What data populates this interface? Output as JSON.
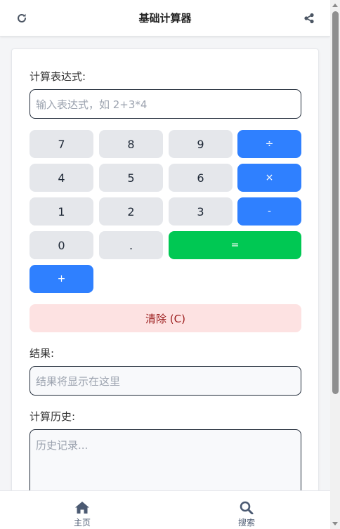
{
  "header": {
    "title": "基础计算器",
    "left_icon": "refresh-icon",
    "right_icon": "share-icon"
  },
  "calculator": {
    "expression_label": "计算表达式:",
    "expression_placeholder": "输入表达式，如 2+3*4",
    "keys": {
      "k7": "7",
      "k8": "8",
      "k9": "9",
      "div": "÷",
      "k4": "4",
      "k5": "5",
      "k6": "6",
      "mul": "×",
      "k1": "1",
      "k2": "2",
      "k3": "3",
      "sub": "-",
      "k0": "0",
      "dot": ".",
      "eq": "=",
      "add": "+"
    },
    "clear_label": "清除 (C)",
    "result_label": "结果:",
    "result_placeholder": "结果将显示在这里",
    "history_label": "计算历史:",
    "history_placeholder": "历史记录..."
  },
  "bottom_nav": {
    "items": [
      {
        "label": "主页",
        "icon": "home-icon"
      },
      {
        "label": "搜索",
        "icon": "search-icon"
      }
    ]
  },
  "colors": {
    "operator": "#2f80ff",
    "equals": "#00c853",
    "number_key": "#e5e7eb",
    "clear_bg": "#fde2e2",
    "clear_text": "#9b1c1c"
  }
}
